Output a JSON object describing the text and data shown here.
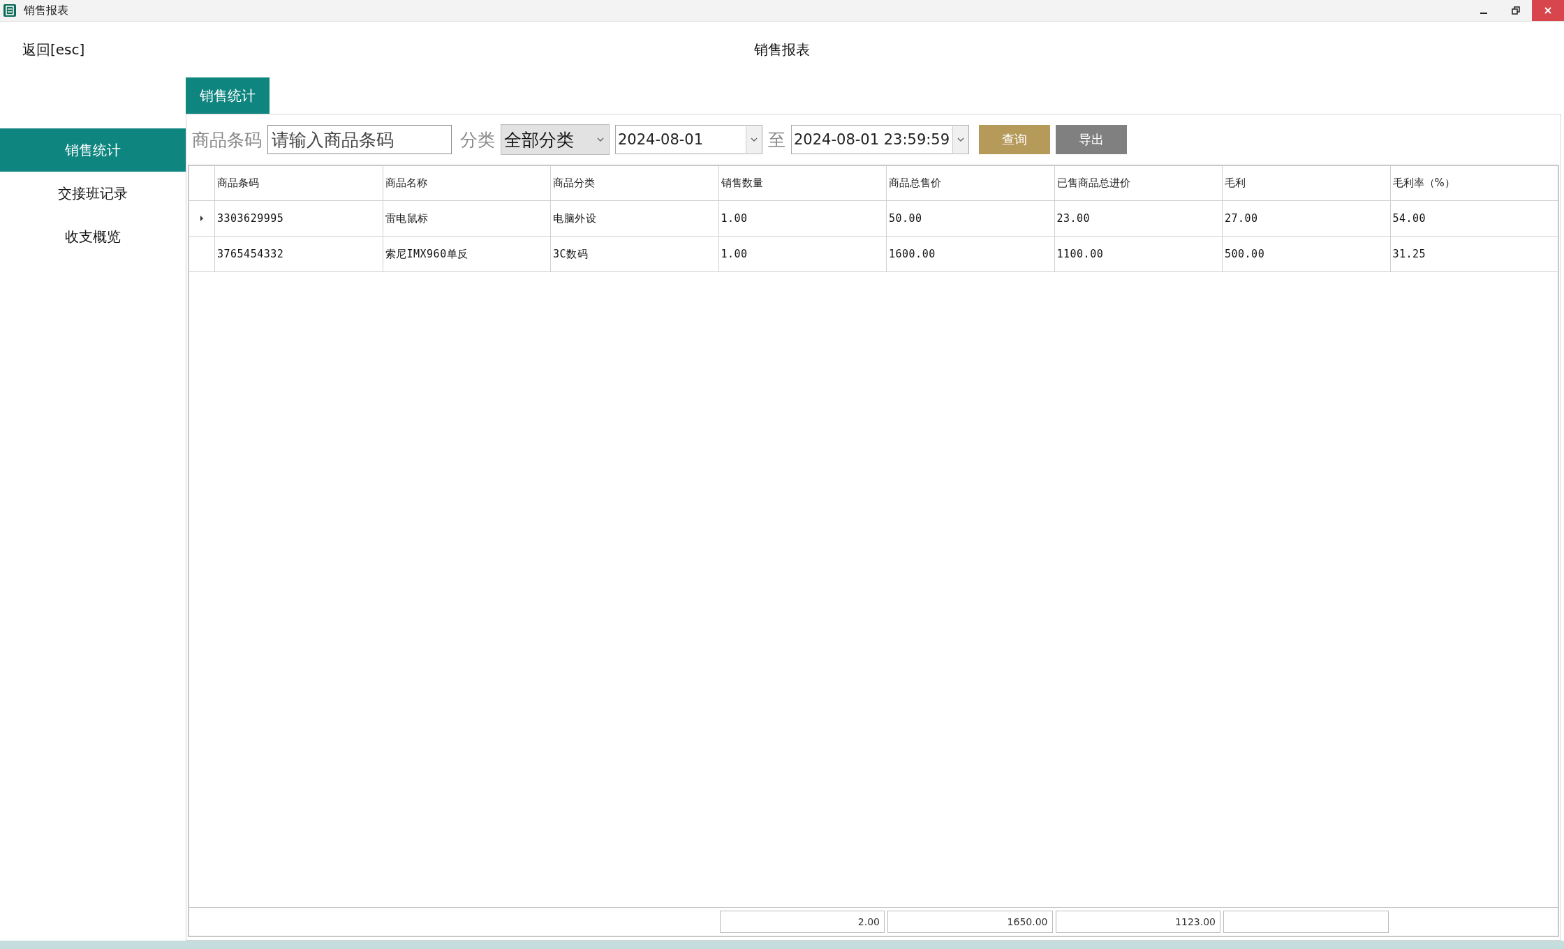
{
  "window": {
    "title": "销售报表"
  },
  "header": {
    "back": "返回[esc]",
    "title": "销售报表"
  },
  "sidebar": {
    "items": [
      {
        "label": "销售统计",
        "selected": true
      },
      {
        "label": "交接班记录",
        "selected": false
      },
      {
        "label": "收支概览",
        "selected": false
      }
    ]
  },
  "tabs": [
    {
      "label": "销售统计",
      "selected": true
    }
  ],
  "filters": {
    "barcode_label": "商品条码",
    "barcode_placeholder": "请输入商品条码",
    "category_label": "分类",
    "category_value": "全部分类",
    "date_from": "2024-08-01",
    "to_label": "至",
    "date_to": "2024-08-01 23:59:59",
    "query_button": "查询",
    "export_button": "导出"
  },
  "table": {
    "columns": [
      "商品条码",
      "商品名称",
      "商品分类",
      "销售数量",
      "商品总售价",
      "已售商品总进价",
      "毛利",
      "毛利率（%）"
    ],
    "rows": [
      {
        "current": true,
        "cells": [
          "3303629995",
          "雷电鼠标",
          "电脑外设",
          "1.00",
          "50.00",
          "23.00",
          "27.00",
          "54.00"
        ]
      },
      {
        "current": false,
        "cells": [
          "3765454332",
          "索尼IMX960单反",
          "3C数码",
          "1.00",
          "1600.00",
          "1100.00",
          "500.00",
          "31.25"
        ]
      }
    ]
  },
  "totals": [
    "2.00",
    "1650.00",
    "1123.00"
  ]
}
